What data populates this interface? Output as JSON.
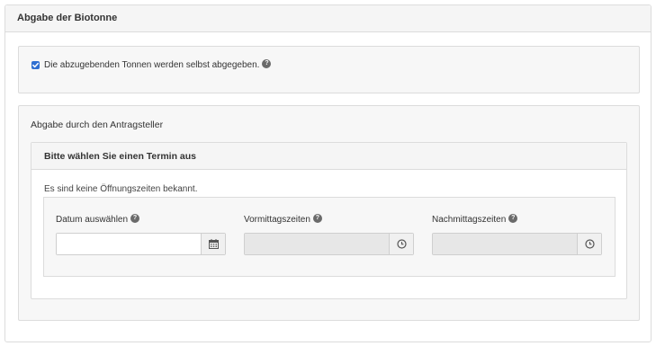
{
  "panel": {
    "title": "Abgabe der Biotonne"
  },
  "self_delivery": {
    "checked": true,
    "label": "Die abzugebenden Tonnen werden selbst abgegeben.",
    "help_icon": "question-circle-icon"
  },
  "applicant": {
    "title": "Abgabe durch den Antragsteller",
    "appointment": {
      "title": "Bitte wählen Sie einen Termin aus",
      "note": "Es sind keine Öffnungszeiten bekannt.",
      "date": {
        "label": "Datum auswählen",
        "value": "",
        "icon": "calendar-icon"
      },
      "morning": {
        "label": "Vormittagszeiten",
        "value": "",
        "disabled": true,
        "icon": "clock-icon"
      },
      "afternoon": {
        "label": "Nachmittagszeiten",
        "value": "",
        "disabled": true,
        "icon": "clock-icon"
      }
    }
  },
  "colors": {
    "accent": "#2f6fd1",
    "header_bg": "#f5f5f5",
    "well_bg": "#f7f7f7",
    "border": "#dcdcdc"
  }
}
